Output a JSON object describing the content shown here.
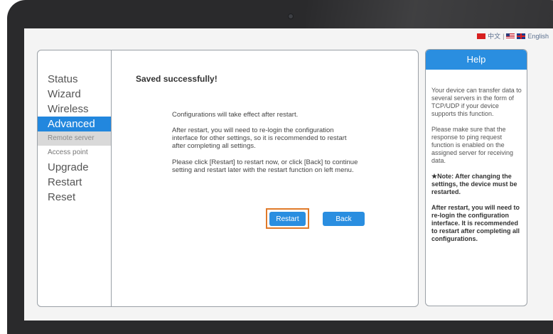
{
  "language": {
    "chinese_label": "中文",
    "separator": "|",
    "english_label": "English"
  },
  "sidebar": {
    "items": [
      {
        "label": "Status"
      },
      {
        "label": "Wizard"
      },
      {
        "label": "Wireless"
      },
      {
        "label": "Advanced"
      },
      {
        "label": "Remote server"
      },
      {
        "label": "Access point"
      },
      {
        "label": "Upgrade"
      },
      {
        "label": "Restart"
      },
      {
        "label": "Reset"
      }
    ]
  },
  "main": {
    "title": "Saved successfully!",
    "messages": [
      "Configurations will take effect after restart.",
      "After restart, you will need to re-login the configuration interface for other settings, so it is recommended to restart after completing all settings.",
      "Please click [Restart] to restart now, or click [Back] to continue setting and restart later with the restart function on left menu."
    ],
    "restart_label": "Restart",
    "back_label": "Back"
  },
  "help": {
    "title": "Help",
    "paragraphs": [
      "Your device can transfer data to several servers in the form of TCP/UDP if your device supports this function.",
      "Please make sure that the response to ping request function is enabled on the assigned server for receiving data.",
      "★Note: After changing the settings, the device must be restarted.",
      "After restart, you will need to re-login the configuration interface. It is recommended to restart after completing all configurations."
    ]
  },
  "colors": {
    "accent": "#2a8ee0",
    "highlight_frame": "#e07a2a",
    "bezel": "#2a2a2c"
  }
}
